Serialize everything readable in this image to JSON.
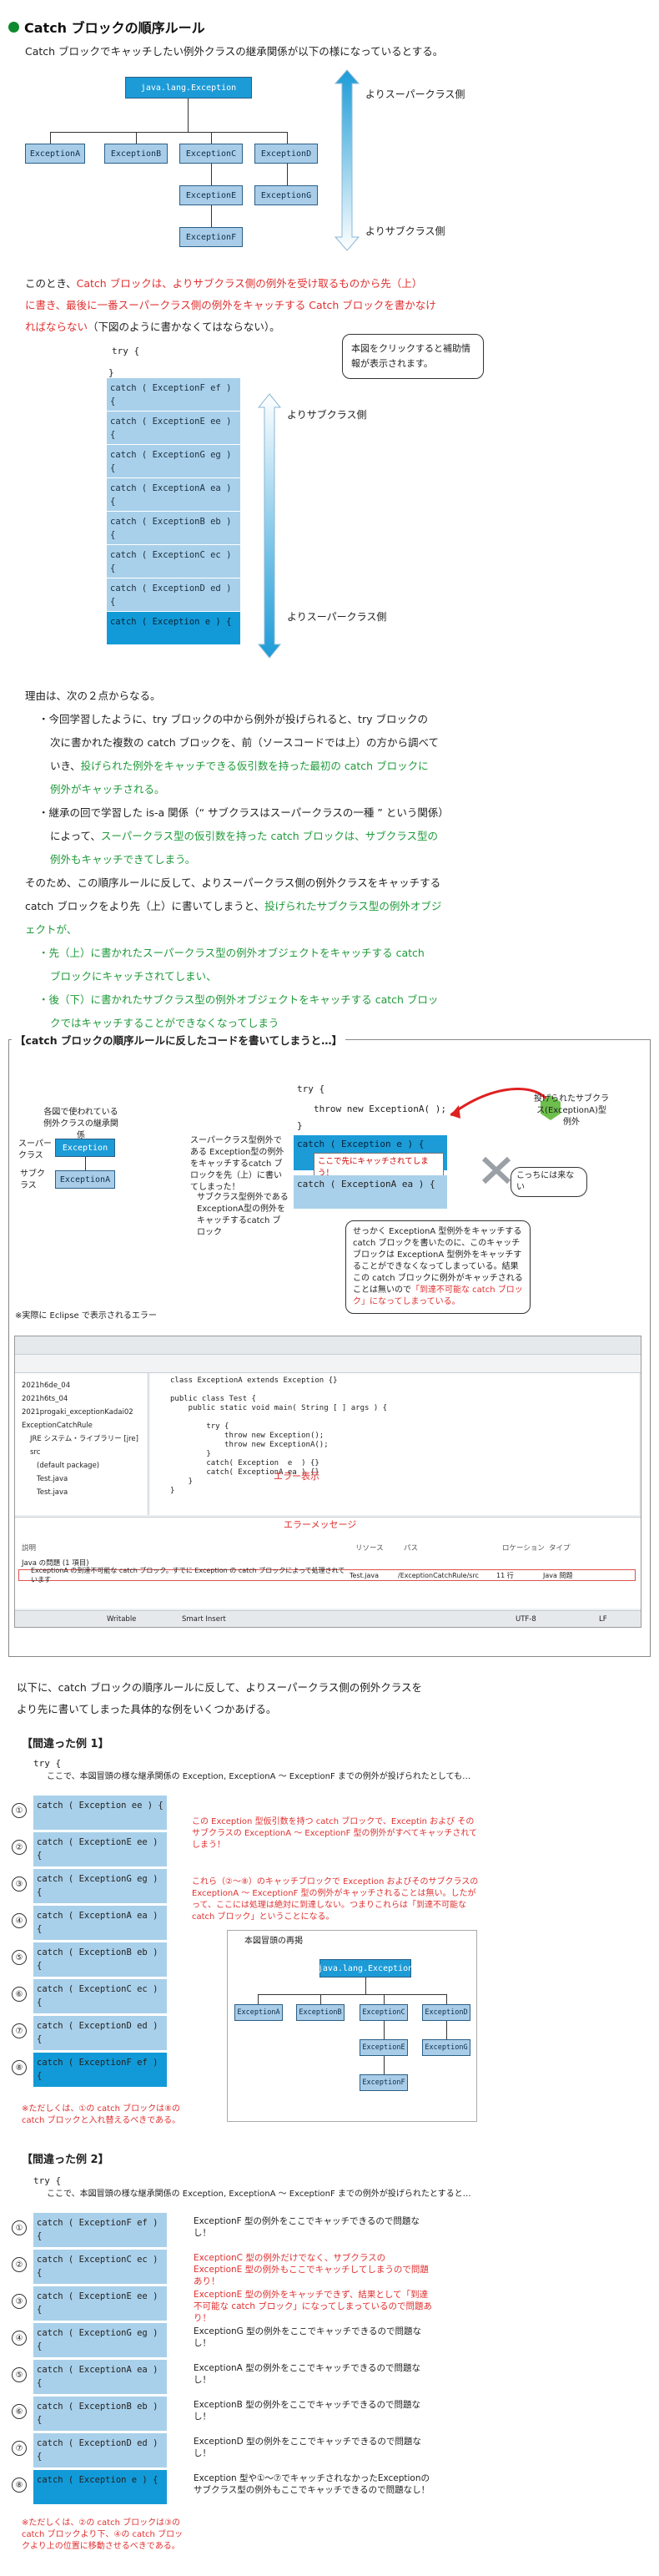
{
  "title": "Catch ブロックの順序ルール",
  "intro": "Catch ブロックでキャッチしたい例外クラスの継承関係が以下の様になっているとする。",
  "hierarchy": {
    "root": "java.lang.Exception",
    "level1": [
      "ExceptionA",
      "ExceptionB",
      "ExceptionC",
      "ExceptionD"
    ],
    "level2": [
      "ExceptionE",
      "ExceptionG"
    ],
    "level3": [
      "ExceptionF"
    ],
    "super_label": "よりスーパークラス側",
    "sub_label": "よりサブクラス側"
  },
  "rule": {
    "line1_a": "このとき、",
    "line1_b": "Catch ブロックは、よりサブクラス側の例外を受け取るものから先（上）",
    "line2": "に書き、最後に一番スーパークラス側の例外をキャッチする Catch ブロックを書かなけ",
    "line3_a": "ればならない",
    "line3_b": "（下図のように書かなくてはならない）。"
  },
  "code1": {
    "try_open": "try {",
    "try_close": "}",
    "blocks": [
      "catch ( ExceptionF ef ) {",
      "catch ( ExceptionE ee ) {",
      "catch ( ExceptionG eg ) {",
      "catch ( ExceptionA ea ) {",
      "catch ( ExceptionB eb ) {",
      "catch ( ExceptionC ec ) {",
      "catch ( ExceptionD ed ) {",
      "catch ( Exception  e ) {"
    ],
    "close": "}",
    "note": "本図をクリックすると補助情報が表示されます。",
    "sub_label": "よりサブクラス側",
    "super_label": "よりスーパークラス側"
  },
  "reason": {
    "lead": "理由は、次の２点からなる。",
    "b1_l1": "・今回学習したように、try ブロックの中から例外が投げられると、try ブロックの",
    "b1_l2": "次に書かれた複数の catch ブロックを、前（ソースコードでは上）の方から調べて",
    "b1_l3_a": "いき、",
    "b1_l3_b": "投げられた例外をキャッチできる仮引数を持った最初の catch ブロックに",
    "b1_l4": "例外がキャッチされる。",
    "b2_l1": "・継承の回で学習した is-a 関係（“ サブクラスはスーパークラスの一種 ” という関係）",
    "b2_l2_a": "によって、",
    "b2_l2_b": "スーパークラス型の仮引数を持った catch ブロックは、サブクラス型の",
    "b2_l3": "例外もキャッチできてしまう。",
    "c1": "そのため、この順序ルールに反して、よりスーパークラス側の例外クラスをキャッチする",
    "c2_a": "catch ブロックをより先（上）に書いてしまうと、",
    "c2_b": "投げられたサブクラス型の例外オブジ",
    "c3": "ェクトが、",
    "d1": "・先（上）に書かれたスーパークラス型の例外オブジェクトをキャッチする catch",
    "d2": "ブロックにキャッチされてしまい、",
    "d3": "・後（下）に書かれたサブクラス型の例外オブジェクトをキャッチする catch ブロッ",
    "d4": "クではキャッチすることができなくなってしまう",
    "e_a": "のである（",
    "e_b": "「到達不可能な catch ブロック」というエラーが出る",
    "e_c": "）。"
  },
  "section2": {
    "label": "【catch ブロックの順序ルールに反したコードを書いてしまうと…】",
    "mini_top": "各図で使われている例外クラスの継承関係",
    "super": "スーパークラス",
    "sub": "サブクラス",
    "exception": "Exception",
    "exceptionA": "ExceptionA",
    "left_top": "スーパークラス型例外である Exception型の例外をキャッチするcatch ブロックを先（上）に書いてしまった！",
    "left_bottom": "サブクラス型例外である ExceptionA型の例外をキャッチするcatch ブロック",
    "code_try": "try {",
    "code_throw": "throw new ExceptionA( );",
    "code_close": "}",
    "code_catch1": "catch ( Exception  e ) {",
    "code_here": "ここで先にキャッチされてしまう！",
    "code_catch2": "catch ( ExceptionA ea ) {",
    "thrown_label": "投げられたサブクラス(ExceptionA)型例外",
    "not_here": "こっちには来ない",
    "explain": "せっかく ExceptionA 型例外をキャッチする catch ブロックを書いたのに、このキャッチブロックは ExceptionA 型例外をキャッチすることができなくなってしまっている。結果この catch ブロックに例外がキャッチされることは無いので",
    "explain_red": "「到達不可能な catch ブロック」になってしまっている。",
    "eclipse_caption": "※実際に Eclipse で表示されるエラー",
    "err_display": "エラー表示",
    "err_message": "エラーメッセージ",
    "eclipse_code": [
      "class ExceptionA extends Exception {}",
      "",
      "public class Test {",
      "    public static void main( String [ ] args ) {",
      "",
      "        try {",
      "            throw new Exception();",
      "            throw new ExceptionA();",
      "        }",
      "        catch( Exception  e  ) {}",
      "        catch( ExceptionA ea ) {}",
      "    }",
      "}"
    ],
    "eclipse_tree": [
      "2021h6de_04",
      "2021h6ts_04",
      "2021progaki_exceptionKadai02",
      "ExceptionCatchRule",
      "JRE システム・ライブラリー [jre]",
      "src",
      "(default package)",
      "Test.java",
      "Test.java"
    ],
    "marker_headers": [
      "説明",
      "リソース",
      "パス",
      "ロケーション",
      "タイプ"
    ],
    "marker_group": "Java の問題 (1 項目)",
    "marker_row": "ExceptionA の到達不可能な catch ブロック。すでに Exception の catch ブロックによって処理されています",
    "marker_res": "Test.java",
    "marker_path": "/ExceptionCatchRule/src",
    "marker_loc": "11 行",
    "marker_type": "Java 問題",
    "status": [
      "Writable",
      "Smart Insert",
      "UTF-8",
      "LF"
    ]
  },
  "outro": {
    "l1": "以下に、catch ブロックの順序ルールに反して、よりスーパークラス側の例外クラスを",
    "l2": "より先に書いてしまった具体的な例をいくつかあげる。"
  },
  "example1": {
    "heading": "【間違った例 1】",
    "try": "try {",
    "comment": "ここで、本図冒頭の様な継承関係の Exception, ExceptionA 〜 ExceptionF までの例外が投げられたとしても…",
    "blocks": [
      "catch ( Exception  ee ) {",
      "catch ( ExceptionE ee ) {",
      "catch ( ExceptionG eg ) {",
      "catch ( ExceptionA ea ) {",
      "catch ( ExceptionB eb ) {",
      "catch ( ExceptionC ec ) {",
      "catch ( ExceptionD ed ) {",
      "catch ( ExceptionF ef ) {"
    ],
    "nums": [
      "①",
      "②",
      "③",
      "④",
      "⑤",
      "⑥",
      "⑦",
      "⑧"
    ],
    "red1": "この Exception 型仮引数を持つ catch ブロックで、Exceptin および そのサブクラスの ExceptionA 〜 ExceptionF 型の例外がすべてキャッチされてしまう！",
    "red2": "これら（②〜⑧）のキャッチブロックで Exception およびそのサブクラスの ExceptionA 〜 ExceptionF 型の例外がキャッチされることは無い。したがって、ここには処理は絶対に到達しない。つまりこれらは「到達不可能な catch ブロック」ということになる。",
    "mini_title": "本図冒頭の再掲",
    "footnote": "※ただしくは、①の catch ブロックは⑧の catch ブロックと入れ替えるべきである。"
  },
  "example2": {
    "heading": "【間違った例 2】",
    "try": "try {",
    "comment": "ここで、本図冒頭の様な継承関係の Exception, ExceptionA 〜 ExceptionF までの例外が投げられたとすると…",
    "blocks": [
      "catch ( ExceptionF ef ) {",
      "catch ( ExceptionC ec ) {",
      "catch ( ExceptionE ee ) {",
      "catch ( ExceptionG eg ) {",
      "catch ( ExceptionA ea ) {",
      "catch ( ExceptionB eb ) {",
      "catch ( ExceptionD ed ) {",
      "catch ( Exception  e ) {"
    ],
    "nums": [
      "①",
      "②",
      "③",
      "④",
      "⑤",
      "⑥",
      "⑦",
      "⑧"
    ],
    "comments": [
      "ExceptionF 型の例外をここでキャッチできるので問題なし！",
      "ExceptionC 型の例外だけでなく、サブクラスの ExceptionE 型の例外もここでキャッチしてしまうので問題あり！",
      "ExceptionE 型の例外をキャッチできず、結果として「到達不可能な catch ブロック」になってしまっているので問題あり！",
      "ExceptionG 型の例外をここでキャッチできるので問題なし！",
      "ExceptionA 型の例外をここでキャッチできるので問題なし！",
      "ExceptionB 型の例外をここでキャッチできるので問題なし！",
      "ExceptionD 型の例外をここでキャッチできるので問題なし！",
      "Exception 型や①〜⑦でキャッチされなかったExceptionのサブクラス型の例外もここでキャッチできるので問題なし！"
    ],
    "comment_red": [
      false,
      true,
      true,
      false,
      false,
      false,
      false,
      false
    ],
    "footnote": "※ただしくは、②の catch ブロックは③の catch ブロックより下、④の catch ブロックより上の位置に移動させるべきである。"
  },
  "colors": {
    "accent": "#1c9bd7",
    "box_fill": "#a9d0ea",
    "red": "#e03030",
    "green": "#1f9a3a",
    "title_dot": "#0e8a2e"
  }
}
